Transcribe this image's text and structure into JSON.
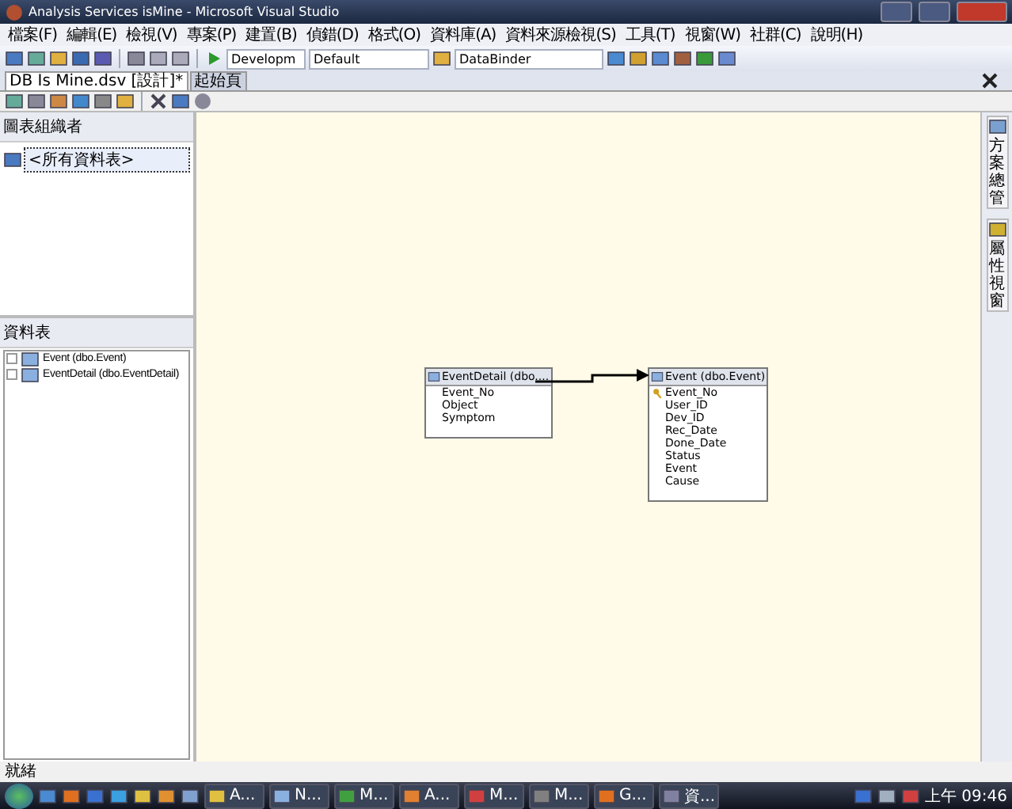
{
  "window": {
    "title": "Analysis Services isMine - Microsoft Visual Studio"
  },
  "menu": [
    "檔案(F)",
    "編輯(E)",
    "檢視(V)",
    "專案(P)",
    "建置(B)",
    "偵錯(D)",
    "格式(O)",
    "資料庫(A)",
    "資料來源檢視(S)",
    "工具(T)",
    "視窗(W)",
    "社群(C)",
    "說明(H)"
  ],
  "toolbar": {
    "dropdowns": [
      {
        "value": "Developm"
      },
      {
        "value": "Default"
      },
      {
        "value": "DataBinder"
      }
    ]
  },
  "document_tabs": [
    {
      "label": "DB Is Mine.dsv [設計]*",
      "selected": true
    },
    {
      "label": "起始頁",
      "selected": false
    }
  ],
  "diagram_organizer": {
    "title": "圖表組織者",
    "items": [
      {
        "label": "<所有資料表>",
        "selected": true
      }
    ]
  },
  "tables_pane": {
    "title": "資料表",
    "items": [
      {
        "label": "Event (dbo.Event)",
        "expanded": false
      },
      {
        "label": "EventDetail (dbo.EventDetail)",
        "expanded": false
      }
    ]
  },
  "diagram": {
    "tables": [
      {
        "title": "EventDetail (dbo....",
        "columns": [
          {
            "name": "Event_No",
            "key": false
          },
          {
            "name": "Object",
            "key": false
          },
          {
            "name": "Symptom",
            "key": false
          }
        ]
      },
      {
        "title": "Event (dbo.Event)",
        "columns": [
          {
            "name": "Event_No",
            "key": true
          },
          {
            "name": "User_ID",
            "key": false
          },
          {
            "name": "Dev_ID",
            "key": false
          },
          {
            "name": "Rec_Date",
            "key": false
          },
          {
            "name": "Done_Date",
            "key": false
          },
          {
            "name": "Status",
            "key": false
          },
          {
            "name": "Event",
            "key": false
          },
          {
            "name": "Cause",
            "key": false
          }
        ]
      }
    ]
  },
  "side_tabs": [
    "方案總管",
    "屬性視窗"
  ],
  "status_bar": "就緒",
  "taskbar": {
    "buttons": [
      {
        "label": "A..."
      },
      {
        "label": "N..."
      },
      {
        "label": "M..."
      },
      {
        "label": "A..."
      },
      {
        "label": "M..."
      },
      {
        "label": "M..."
      },
      {
        "label": "G..."
      },
      {
        "label": "資..."
      }
    ],
    "clock": "上午 09:46"
  }
}
